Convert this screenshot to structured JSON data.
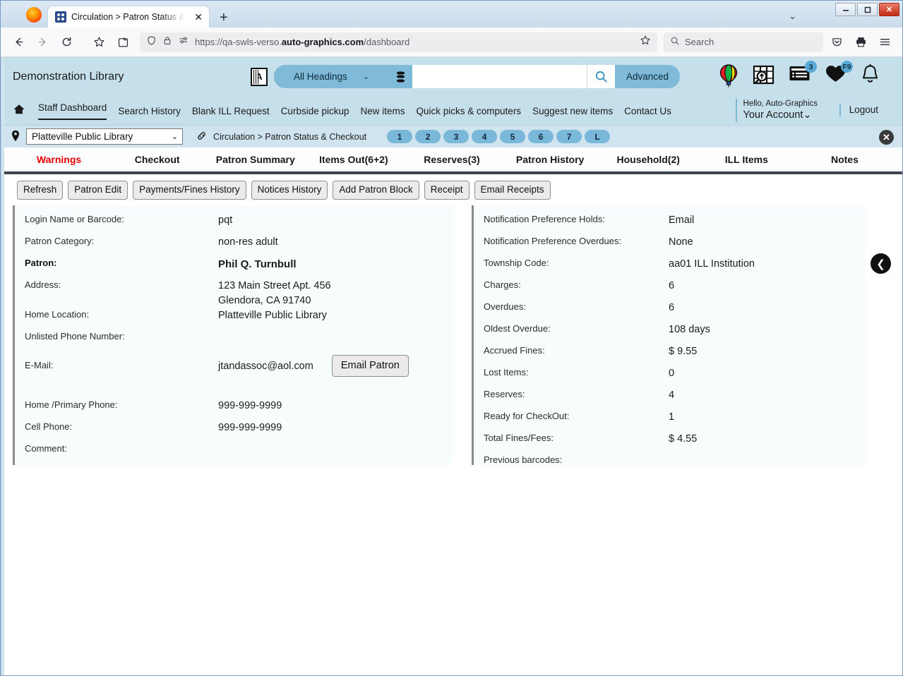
{
  "browser": {
    "tab_title": "Circulation > Patron Status & C",
    "tab_close": "✕",
    "new_tab": "+",
    "url_prefix": "https://qa-swls-verso.",
    "url_bold": "auto-graphics.com",
    "url_suffix": "/dashboard",
    "search_placeholder": "Search",
    "win_minimize": "–",
    "win_maximize": "❐",
    "win_close": "✕",
    "toolbar_chevron": "⌄"
  },
  "header": {
    "library_name": "Demonstration Library",
    "heading_select": "All Headings",
    "heading_chevron": "⌄",
    "search_value": "",
    "search_placeholder": "",
    "advanced_label": "Advanced",
    "marc_icon_letter": "A",
    "icons": [
      {
        "name": "balloon-icon",
        "badge": ""
      },
      {
        "name": "map-search-icon",
        "badge": ""
      },
      {
        "name": "lists-icon",
        "badge": "3"
      },
      {
        "name": "favorites-heart-icon",
        "badge": "F9"
      },
      {
        "name": "notifications-bell-icon",
        "badge": ""
      }
    ]
  },
  "nav": {
    "home_icon": "⌂",
    "links": [
      "Staff Dashboard",
      "Search History",
      "Blank ILL Request",
      "Curbside pickup",
      "New items",
      "Quick picks & computers",
      "Suggest new items",
      "Contact Us"
    ],
    "active_index": 0,
    "hello": "Hello, Auto-Graphics",
    "your_account": "Your Account",
    "account_chevron": "⌄",
    "logout": "Logout"
  },
  "context": {
    "pin_icon": "⚑",
    "location": "Platteville Public Library",
    "location_chevron": "⌄",
    "link_icon": "⚭",
    "breadcrumb": "Circulation > Patron Status & Checkout",
    "pills": [
      "1",
      "2",
      "3",
      "4",
      "5",
      "6",
      "7",
      "L"
    ],
    "close_icon": "✕"
  },
  "tabs": [
    {
      "label": "Warnings",
      "active": true
    },
    {
      "label": "Checkout",
      "active": false
    },
    {
      "label": "Patron Summary",
      "active": false
    },
    {
      "label": "Items Out(6+2)",
      "active": false
    },
    {
      "label": "Reserves(3)",
      "active": false
    },
    {
      "label": "Patron History",
      "active": false
    },
    {
      "label": "Household(2)",
      "active": false
    },
    {
      "label": "ILL Items",
      "active": false
    },
    {
      "label": "Notes",
      "active": false
    }
  ],
  "toolbar": {
    "buttons": [
      "Refresh",
      "Patron Edit",
      "Payments/Fines History",
      "Notices History",
      "Add Patron Block",
      "Receipt",
      "Email Receipts"
    ]
  },
  "left_panel": {
    "rows": [
      {
        "label": "Login Name or Barcode:",
        "value": "pqt",
        "bold_label": false,
        "bold_value": false
      },
      {
        "label": "Patron Category:",
        "value": "non-res adult",
        "bold_label": false,
        "bold_value": false
      },
      {
        "label": "Patron:",
        "value": "Phil Q. Turnbull",
        "bold_label": true,
        "bold_value": true
      },
      {
        "label": "Address:",
        "value": "123 Main Street Apt. 456\nGlendora, CA 91740",
        "bold_label": false,
        "bold_value": false
      },
      {
        "label": "Home Location:",
        "value": "Platteville Public Library",
        "bold_label": false,
        "bold_value": false
      },
      {
        "label": "Unlisted Phone Number:",
        "value": "",
        "bold_label": false,
        "bold_value": false
      },
      {
        "label": "E-Mail:",
        "value": "jtandassoc@aol.com",
        "bold_label": false,
        "bold_value": false,
        "button": "Email Patron"
      },
      {
        "label": "Home /Primary Phone:",
        "value": "999-999-9999",
        "bold_label": false,
        "bold_value": false
      },
      {
        "label": "Cell Phone:",
        "value": "999-999-9999",
        "bold_label": false,
        "bold_value": false
      },
      {
        "label": "Comment:",
        "value": "",
        "bold_label": false,
        "bold_value": false
      }
    ]
  },
  "right_panel": {
    "rows": [
      {
        "label": "Notification Preference Holds:",
        "value": "Email"
      },
      {
        "label": "Notification Preference Overdues:",
        "value": "None"
      },
      {
        "label": "Township Code:",
        "value": "aa01 ILL Institution"
      },
      {
        "label": "Charges:",
        "value": "6"
      },
      {
        "label": "Overdues:",
        "value": "6"
      },
      {
        "label": "Oldest Overdue:",
        "value": "108 days"
      },
      {
        "label": "Accrued Fines:",
        "value": "$ 9.55"
      },
      {
        "label": "Lost Items:",
        "value": "0"
      },
      {
        "label": "Reserves:",
        "value": "4"
      },
      {
        "label": "Ready for CheckOut:",
        "value": "1"
      },
      {
        "label": "Total Fines/Fees:",
        "value": "$ 4.55"
      },
      {
        "label": "Previous barcodes:",
        "value": ""
      }
    ]
  },
  "collapse_button": {
    "icon": "❮"
  },
  "colors": {
    "header_blue": "#c5dfeb",
    "accent_blue": "#7fbbd9",
    "pill_blue": "#79b8d8",
    "warning_red": "#ee0000",
    "panel_bg": "#f7fcfd",
    "tab_underline": "#3c4550"
  }
}
